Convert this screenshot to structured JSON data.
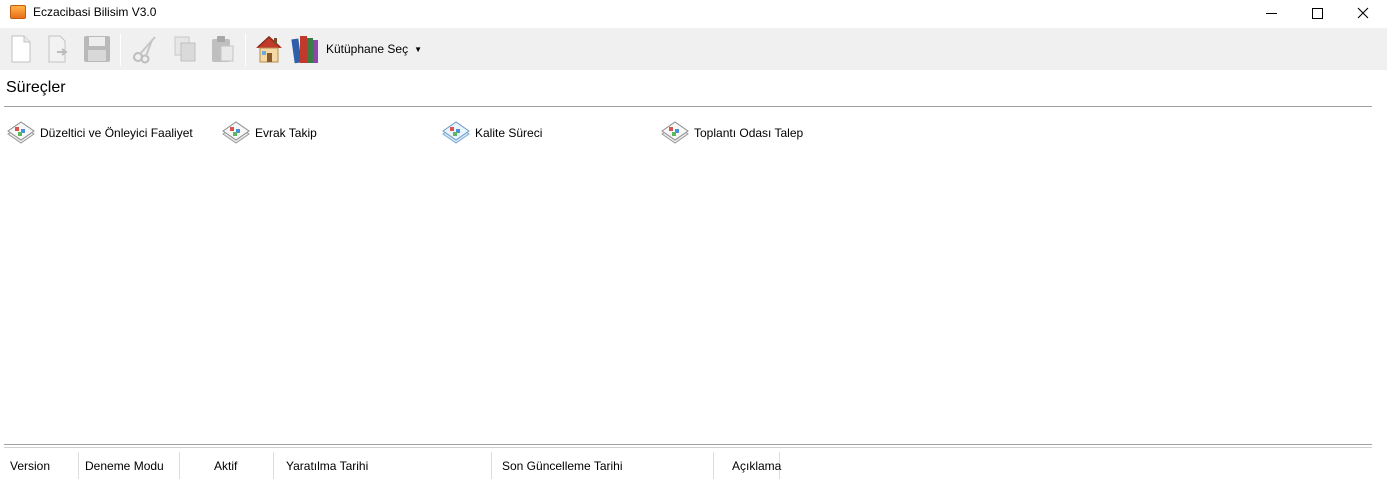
{
  "window": {
    "title": "Eczacibasi Bilisim V3.0",
    "app_icon": "app-icon",
    "accent_color": "#f0a030"
  },
  "toolbar": {
    "buttons": [
      {
        "icon": "new-document-icon",
        "label": "New"
      },
      {
        "icon": "open-document-icon",
        "label": "Open"
      },
      {
        "icon": "save-disk-icon",
        "label": "Save"
      },
      {
        "icon": "scissors-icon",
        "label": "Cut"
      },
      {
        "icon": "copy-icon",
        "label": "Copy"
      },
      {
        "icon": "paste-clipboard-icon",
        "label": "Paste"
      },
      {
        "icon": "home-icon",
        "label": "Home"
      }
    ],
    "library_button": {
      "icon": "books-icon",
      "label": "Kütüphane Seç"
    }
  },
  "section": {
    "title": "Süreçler"
  },
  "processes": [
    {
      "label": "Düzeltici ve Önleyici Faaliyet",
      "icon": "workflow-icon"
    },
    {
      "label": "Evrak Takip",
      "icon": "workflow-icon"
    },
    {
      "label": "Kalite Süreci",
      "icon": "workflow-icon"
    },
    {
      "label": "Toplantı Odası Talep",
      "icon": "workflow-icon"
    }
  ],
  "grid": {
    "columns": [
      "Version",
      "Deneme Modu",
      "Aktif",
      "Yaratılma Tarihi",
      "Son Güncelleme Tarihi",
      "Açıklama"
    ]
  }
}
